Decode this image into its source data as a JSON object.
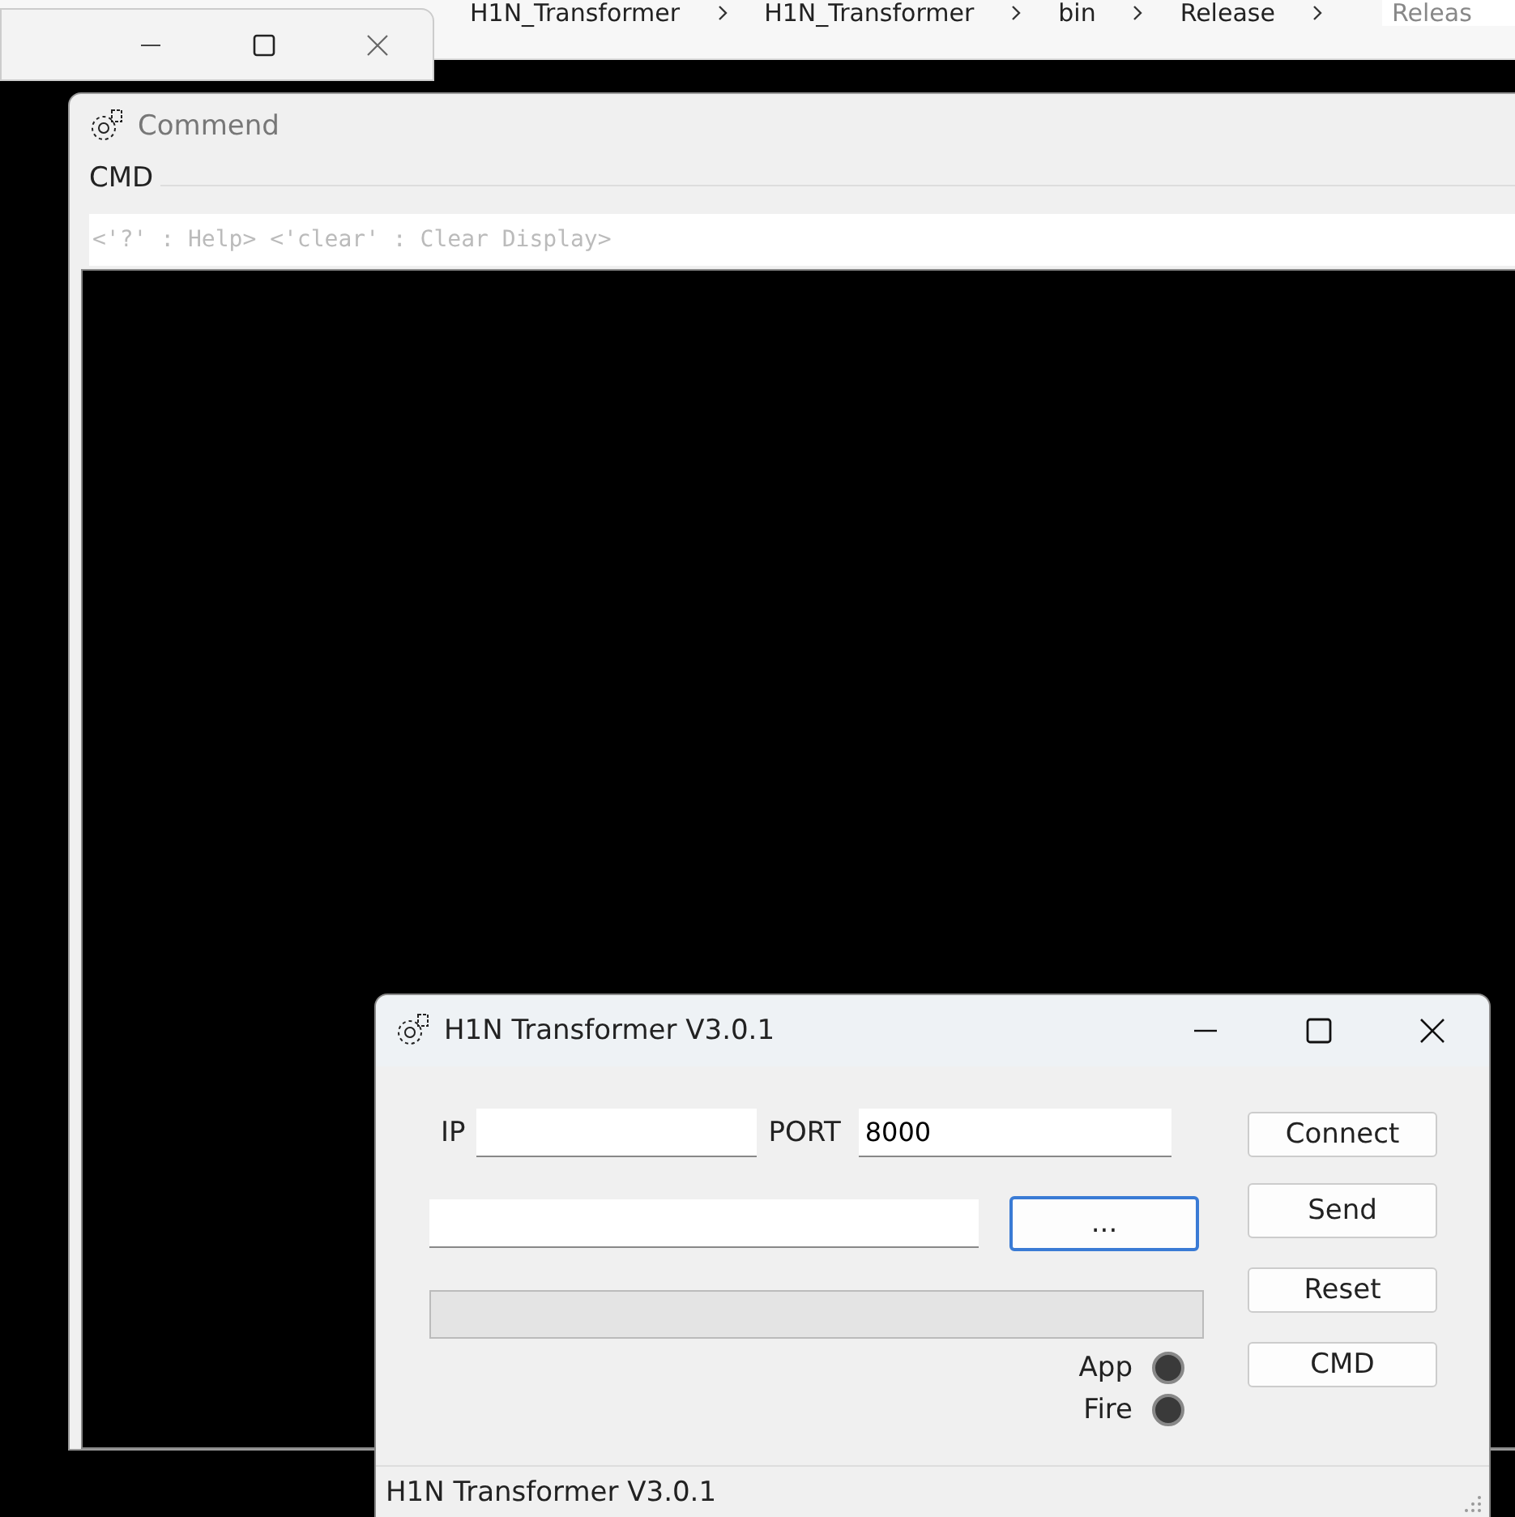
{
  "explorer": {
    "breadcrumbs": [
      "H1N_Transformer",
      "H1N_Transformer",
      "bin",
      "Release"
    ],
    "search_text": "Releas"
  },
  "console_window": {
    "title": "Commend",
    "group_label": "CMD",
    "command_field": {
      "placeholder": "<'?' : Help> <'clear' : Clear Display>"
    }
  },
  "main_window": {
    "title": "H1N Transformer V3.0.1",
    "ip": {
      "label": "IP"
    },
    "port": {
      "label": "PORT",
      "value": "8000"
    },
    "browse_button": {
      "label": "...",
      "focused": true
    },
    "progress": {
      "level": 0
    },
    "indicators": [
      {
        "label": "App",
        "on": false
      },
      {
        "label": "Fire",
        "on": false
      }
    ],
    "buttons": [
      "Connect",
      "Send",
      "Reset",
      "CMD"
    ],
    "status_bar": "H1N Transformer V3.0.1"
  }
}
